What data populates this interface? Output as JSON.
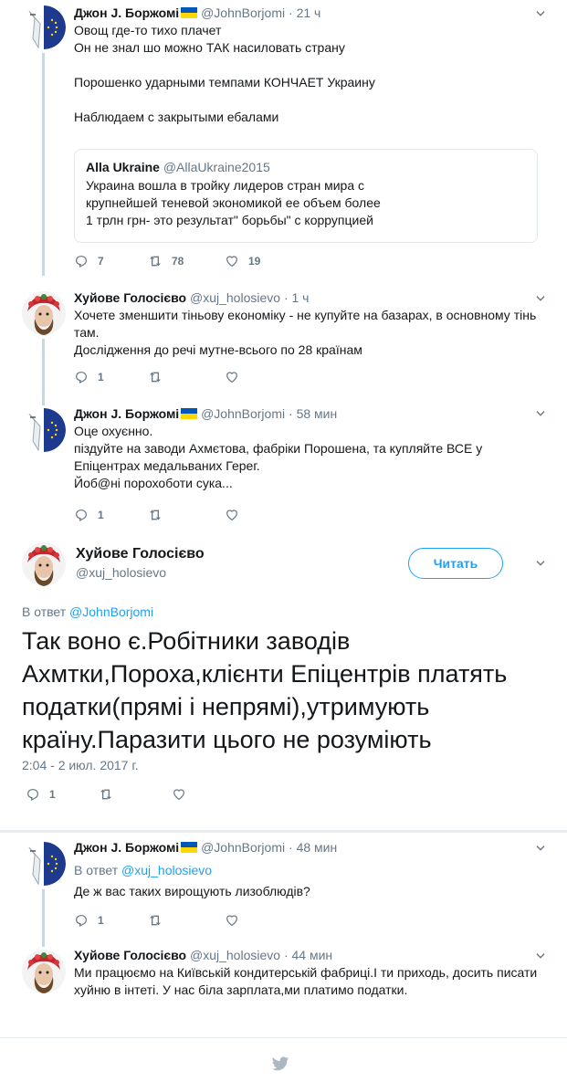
{
  "users": {
    "john": {
      "name": "Джон J. Боржомі",
      "handle": "@JohnBorjomi"
    },
    "xuj": {
      "name": "Хуйове Голосієво",
      "handle": "@xuj_holosievo"
    }
  },
  "tweet1": {
    "time": "21 ч",
    "lines": [
      "Овощ где-то тихо плачет",
      "Он не знал шо можно ТАК насиловать страну",
      "",
      "Порошенко ударными темпами КОНЧАЕТ Украину",
      "",
      "Наблюдаем с закрытыми ебалами"
    ],
    "quote": {
      "name": "Alla Ukraine",
      "handle": "@AllaUkraine2015",
      "lines": [
        "Украина вошла в тройку лидеров стран мира с",
        "крупнейшей теневой экономикой ее объем более",
        "1 трлн грн- это результат\" борьбы\" с коррупцией"
      ]
    },
    "replies": "7",
    "retweets": "78",
    "likes": "19"
  },
  "tweet2": {
    "time": "1 ч",
    "lines": [
      "Хочете зменшити тіньову економіку - не купуйте на базарах, в основному тінь",
      "там.",
      "Дослідження до речі мутне-всього по 28 країнам"
    ],
    "replies": "1"
  },
  "tweet3": {
    "time": "58 мин",
    "lines": [
      "Оце охуєнно.",
      "піздуйте на заводи Ахмєтова, фабріки Порошена, та купляйте ВСЕ у",
      "Епіцентрах медальваних Герег.",
      "Йоб@ні порохоботи сука..."
    ],
    "replies": "1"
  },
  "main": {
    "follow_label": "Читать",
    "reply_prefix": "В ответ",
    "reply_handle": "@JohnBorjomi",
    "lines": [
      "Так воно є.Робітники заводів",
      "Ахмтки,Пороха,клієнти Епіцентрів платять",
      "податки(прямі і непрямі),утримують",
      "країну.Паразити цього не розуміють"
    ],
    "timestamp": "2:04 - 2 июл. 2017 г.",
    "replies": "1"
  },
  "tweet4": {
    "time": "48 мин",
    "reply_prefix": "В ответ",
    "reply_handle": "@xuj_holosievo",
    "lines": [
      "Де ж вас таких вирощують лизоблюдів?"
    ],
    "replies": "1"
  },
  "tweet5": {
    "time": "44 мин",
    "lines": [
      "Ми працюємо на Київській кондитерській фабриці.І ти приходь, досить писати",
      "хуйню в інтеті. У нас біла зарплата,ми платимо податки."
    ]
  },
  "colors": {
    "accent": "#1da1f2",
    "flag_blue": "#0057b7",
    "flag_yellow": "#ffd700",
    "muted": "#657786"
  },
  "icons": [
    "reply-icon",
    "retweet-icon",
    "like-icon",
    "chevron-down-icon",
    "twitter-bird-icon"
  ]
}
